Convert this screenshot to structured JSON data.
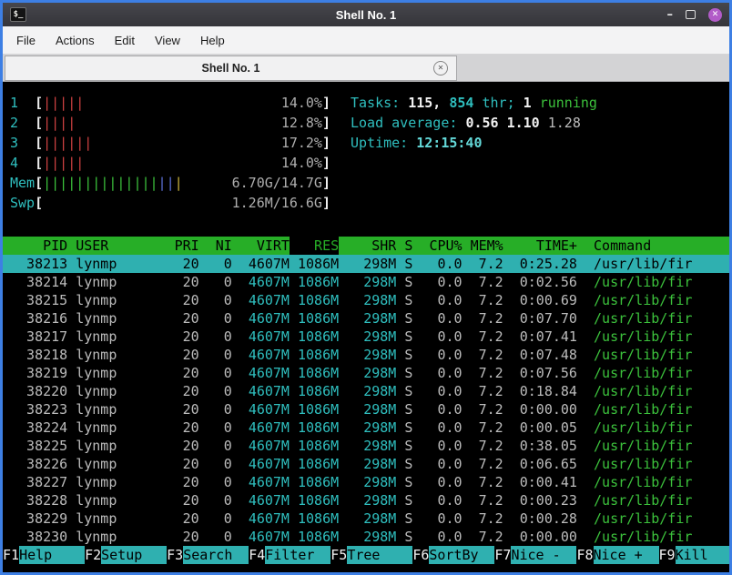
{
  "window": {
    "title": "Shell No. 1",
    "icons": {
      "terminal": "$_",
      "minimize": "–",
      "close": "✕",
      "tab_close": "✕"
    }
  },
  "menu": {
    "items": [
      "File",
      "Actions",
      "Edit",
      "View",
      "Help"
    ]
  },
  "tab": {
    "title": "Shell No. 1"
  },
  "colors": {
    "window_border_blue": "#3d7fe4",
    "titlebar_close_purple": "#b25bc8",
    "terminal_green": "#3cc23c",
    "terminal_cyan": "#2fbfbf",
    "selection_cyan": "#2fb0b0",
    "header_green": "#27ae27",
    "cpu_bar_red": "#cc4040"
  },
  "htop": {
    "meter": {
      "open": "[",
      "close": "]"
    },
    "cpus": [
      {
        "id": "1",
        "bars": "|||||",
        "pct": "14.0%"
      },
      {
        "id": "2",
        "bars": "||||",
        "pct": "12.8%"
      },
      {
        "id": "3",
        "bars": "||||||",
        "pct": "17.2%"
      },
      {
        "id": "4",
        "bars": "|||||",
        "pct": "14.0%"
      }
    ],
    "mem": {
      "label": "Mem",
      "bars_green": "||||||||||||||",
      "bars_blue": "||",
      "bars_yellow": "|",
      "value": "6.70G/14.7G"
    },
    "swp": {
      "label": "Swp",
      "bars": "",
      "value": "1.26M/16.6G"
    },
    "tasks": {
      "label": "Tasks: ",
      "count": "115, ",
      "threads": "854",
      "thr_text": " thr; ",
      "running_count": "1",
      "running_text": " running"
    },
    "load": {
      "label": "Load average: ",
      "one": "0.56 ",
      "five": "1.10 ",
      "fifteen": "1.28"
    },
    "uptime": {
      "label": "Uptime: ",
      "value": "12:15:40"
    },
    "columns": [
      {
        "key": "pid",
        "label": "PID"
      },
      {
        "key": "user",
        "label": "USER"
      },
      {
        "key": "pri",
        "label": "PRI"
      },
      {
        "key": "ni",
        "label": "NI"
      },
      {
        "key": "virt",
        "label": "VIRT"
      },
      {
        "key": "res",
        "label": "RES",
        "sorted": true
      },
      {
        "key": "shr",
        "label": "SHR"
      },
      {
        "key": "s",
        "label": "S"
      },
      {
        "key": "cpu",
        "label": "CPU%"
      },
      {
        "key": "mem",
        "label": "MEM%"
      },
      {
        "key": "time",
        "label": "TIME+"
      },
      {
        "key": "cmd",
        "label": "Command"
      }
    ],
    "rows": [
      {
        "pid": "38213",
        "user": "lynmp",
        "pri": "20",
        "ni": "0",
        "virt": "4607M",
        "res": "1086M",
        "shr": "298M",
        "s": "S",
        "cpu": "0.0",
        "mem": "7.2",
        "time": "0:25.28",
        "cmd": "/usr/lib/fir",
        "selected": true
      },
      {
        "pid": "38214",
        "user": "lynmp",
        "pri": "20",
        "ni": "0",
        "virt": "4607M",
        "res": "1086M",
        "shr": "298M",
        "s": "S",
        "cpu": "0.0",
        "mem": "7.2",
        "time": "0:02.56",
        "cmd": "/usr/lib/fir"
      },
      {
        "pid": "38215",
        "user": "lynmp",
        "pri": "20",
        "ni": "0",
        "virt": "4607M",
        "res": "1086M",
        "shr": "298M",
        "s": "S",
        "cpu": "0.0",
        "mem": "7.2",
        "time": "0:00.69",
        "cmd": "/usr/lib/fir"
      },
      {
        "pid": "38216",
        "user": "lynmp",
        "pri": "20",
        "ni": "0",
        "virt": "4607M",
        "res": "1086M",
        "shr": "298M",
        "s": "S",
        "cpu": "0.0",
        "mem": "7.2",
        "time": "0:07.70",
        "cmd": "/usr/lib/fir"
      },
      {
        "pid": "38217",
        "user": "lynmp",
        "pri": "20",
        "ni": "0",
        "virt": "4607M",
        "res": "1086M",
        "shr": "298M",
        "s": "S",
        "cpu": "0.0",
        "mem": "7.2",
        "time": "0:07.41",
        "cmd": "/usr/lib/fir"
      },
      {
        "pid": "38218",
        "user": "lynmp",
        "pri": "20",
        "ni": "0",
        "virt": "4607M",
        "res": "1086M",
        "shr": "298M",
        "s": "S",
        "cpu": "0.0",
        "mem": "7.2",
        "time": "0:07.48",
        "cmd": "/usr/lib/fir"
      },
      {
        "pid": "38219",
        "user": "lynmp",
        "pri": "20",
        "ni": "0",
        "virt": "4607M",
        "res": "1086M",
        "shr": "298M",
        "s": "S",
        "cpu": "0.0",
        "mem": "7.2",
        "time": "0:07.56",
        "cmd": "/usr/lib/fir"
      },
      {
        "pid": "38220",
        "user": "lynmp",
        "pri": "20",
        "ni": "0",
        "virt": "4607M",
        "res": "1086M",
        "shr": "298M",
        "s": "S",
        "cpu": "0.0",
        "mem": "7.2",
        "time": "0:18.84",
        "cmd": "/usr/lib/fir"
      },
      {
        "pid": "38223",
        "user": "lynmp",
        "pri": "20",
        "ni": "0",
        "virt": "4607M",
        "res": "1086M",
        "shr": "298M",
        "s": "S",
        "cpu": "0.0",
        "mem": "7.2",
        "time": "0:00.00",
        "cmd": "/usr/lib/fir"
      },
      {
        "pid": "38224",
        "user": "lynmp",
        "pri": "20",
        "ni": "0",
        "virt": "4607M",
        "res": "1086M",
        "shr": "298M",
        "s": "S",
        "cpu": "0.0",
        "mem": "7.2",
        "time": "0:00.05",
        "cmd": "/usr/lib/fir"
      },
      {
        "pid": "38225",
        "user": "lynmp",
        "pri": "20",
        "ni": "0",
        "virt": "4607M",
        "res": "1086M",
        "shr": "298M",
        "s": "S",
        "cpu": "0.0",
        "mem": "7.2",
        "time": "0:38.05",
        "cmd": "/usr/lib/fir"
      },
      {
        "pid": "38226",
        "user": "lynmp",
        "pri": "20",
        "ni": "0",
        "virt": "4607M",
        "res": "1086M",
        "shr": "298M",
        "s": "S",
        "cpu": "0.0",
        "mem": "7.2",
        "time": "0:06.65",
        "cmd": "/usr/lib/fir"
      },
      {
        "pid": "38227",
        "user": "lynmp",
        "pri": "20",
        "ni": "0",
        "virt": "4607M",
        "res": "1086M",
        "shr": "298M",
        "s": "S",
        "cpu": "0.0",
        "mem": "7.2",
        "time": "0:00.41",
        "cmd": "/usr/lib/fir"
      },
      {
        "pid": "38228",
        "user": "lynmp",
        "pri": "20",
        "ni": "0",
        "virt": "4607M",
        "res": "1086M",
        "shr": "298M",
        "s": "S",
        "cpu": "0.0",
        "mem": "7.2",
        "time": "0:00.23",
        "cmd": "/usr/lib/fir"
      },
      {
        "pid": "38229",
        "user": "lynmp",
        "pri": "20",
        "ni": "0",
        "virt": "4607M",
        "res": "1086M",
        "shr": "298M",
        "s": "S",
        "cpu": "0.0",
        "mem": "7.2",
        "time": "0:00.28",
        "cmd": "/usr/lib/fir"
      },
      {
        "pid": "38230",
        "user": "lynmp",
        "pri": "20",
        "ni": "0",
        "virt": "4607M",
        "res": "1086M",
        "shr": "298M",
        "s": "S",
        "cpu": "0.0",
        "mem": "7.2",
        "time": "0:00.00",
        "cmd": "/usr/lib/fir"
      }
    ],
    "fkeys": [
      {
        "key": "F1",
        "label": "Help"
      },
      {
        "key": "F2",
        "label": "Setup"
      },
      {
        "key": "F3",
        "label": "Search"
      },
      {
        "key": "F4",
        "label": "Filter"
      },
      {
        "key": "F5",
        "label": "Tree"
      },
      {
        "key": "F6",
        "label": "SortBy"
      },
      {
        "key": "F7",
        "label": "Nice -"
      },
      {
        "key": "F8",
        "label": "Nice +"
      },
      {
        "key": "F9",
        "label": "Kill"
      }
    ]
  }
}
